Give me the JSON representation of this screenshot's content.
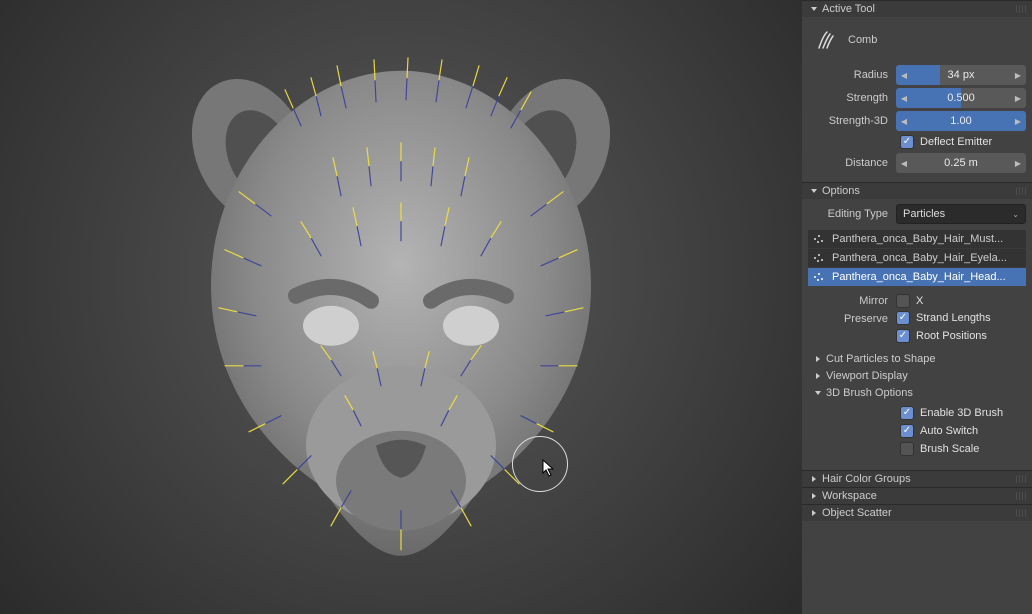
{
  "panels": {
    "active_tool": {
      "title": "Active Tool",
      "tool_name": "Comb"
    },
    "options": {
      "title": "Options"
    },
    "cut_particles": {
      "title": "Cut Particles to Shape"
    },
    "viewport_display": {
      "title": "Viewport Display"
    },
    "brush3d": {
      "title": "3D Brush Options"
    },
    "hair_color_groups": {
      "title": "Hair Color Groups"
    },
    "workspace": {
      "title": "Workspace"
    },
    "object_scatter": {
      "title": "Object Scatter"
    }
  },
  "tool": {
    "radius_label": "Radius",
    "radius_value": "34 px",
    "radius_pct": 34,
    "strength_label": "Strength",
    "strength_value": "0.500",
    "strength_pct": 50,
    "strength3d_label": "Strength-3D",
    "strength3d_value": "1.00",
    "strength3d_pct": 100,
    "deflect_emitter_label": "Deflect Emitter",
    "distance_label": "Distance",
    "distance_value": "0.25 m"
  },
  "options": {
    "editing_type_label": "Editing Type",
    "editing_type_value": "Particles",
    "systems": [
      {
        "label": "Panthera_onca_Baby_Hair_Must...",
        "selected": false
      },
      {
        "label": "Panthera_onca_Baby_Hair_Eyela...",
        "selected": false
      },
      {
        "label": "Panthera_onca_Baby_Hair_Head...",
        "selected": true
      }
    ],
    "mirror_label": "Mirror",
    "mirror_x_label": "X",
    "preserve_label": "Preserve",
    "strand_lengths_label": "Strand Lengths",
    "root_positions_label": "Root Positions"
  },
  "brush3d": {
    "enable_label": "Enable 3D Brush",
    "auto_switch_label": "Auto Switch",
    "brush_scale_label": "Brush Scale"
  }
}
